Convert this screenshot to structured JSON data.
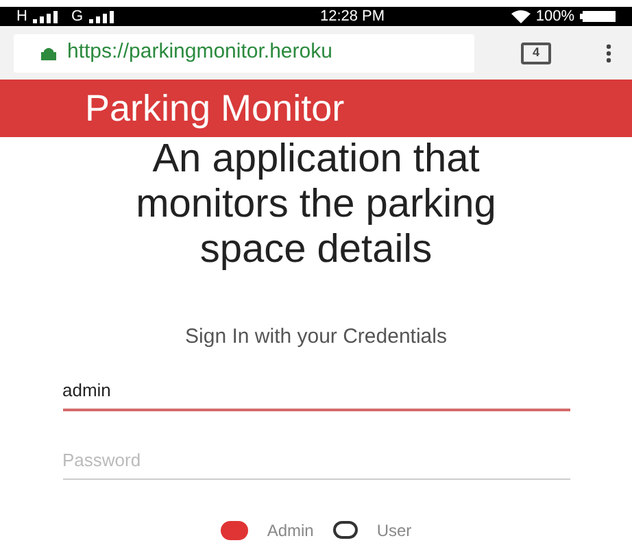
{
  "status_bar": {
    "network_1": "H",
    "network_2": "G",
    "time": "12:28 PM",
    "battery": "100%"
  },
  "browser": {
    "url": "https://parkingmonitor.heroku",
    "tab_count": "4"
  },
  "header": {
    "title": "Parking Monitor"
  },
  "heading": "An application that monitors the parking space details",
  "sign_in": {
    "title": "Sign In with your Credentials",
    "fields": [
      {
        "kind": "text",
        "value": "admin",
        "focused": true
      },
      {
        "kind": "password",
        "placeholder": "Password",
        "focused": false
      }
    ],
    "roles": [
      {
        "label": "Admin",
        "selected": true
      },
      {
        "label": "User",
        "selected": false
      }
    ]
  }
}
